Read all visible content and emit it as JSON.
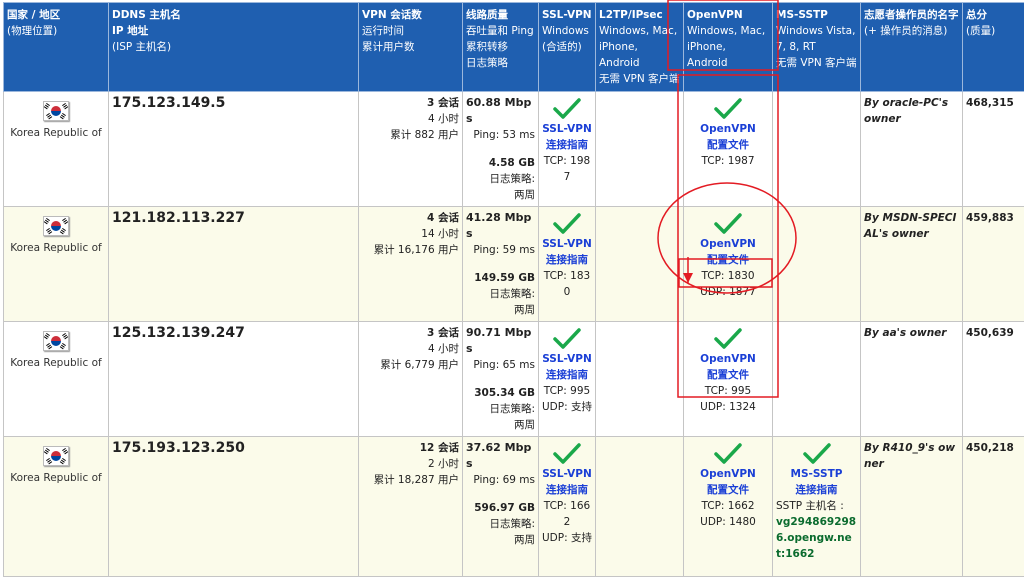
{
  "headers": {
    "country": [
      "国家 / 地区",
      "(物理位置)"
    ],
    "ddns": [
      "DDNS 主机名",
      "IP 地址",
      "(ISP 主机名)"
    ],
    "sessions": [
      "VPN 会话数",
      "运行时间",
      "累计用户数"
    ],
    "line": [
      "线路质量",
      "吞吐量和 Ping",
      "累积转移",
      "日志策略"
    ],
    "ssl": [
      "SSL-VPN",
      "Windows",
      "(合适的)"
    ],
    "l2tp": [
      "L2TP/IPsec",
      "Windows, Mac,",
      "iPhone, Android",
      "无需 VPN 客户端"
    ],
    "openvpn": [
      "OpenVPN",
      "Windows, Mac,",
      "iPhone, Android"
    ],
    "sstp": [
      "MS-SSTP",
      "Windows Vista,",
      "7, 8, RT",
      "无需 VPN 客户端"
    ],
    "owner": [
      "志愿者操作员的名字",
      "(+ 操作员的消息)"
    ],
    "score": [
      "总分",
      "(质量)"
    ]
  },
  "common": {
    "ssl_name": "SSL-VPN",
    "ssl_guide": "连接指南",
    "openvpn_name": "OpenVPN",
    "openvpn_config": "配置文件",
    "log_policy_label": "日志策略:",
    "sstp_name": "MS-SSTP",
    "sstp_guide": "连接指南",
    "sstp_host_label": "SSTP 主机名 :"
  },
  "rows": [
    {
      "country": "Korea Republic of",
      "ip": "175.123.149.5",
      "sessions": "3 会话",
      "uptime": "4 小时",
      "users": "累计 882 用户",
      "throughput": "60.88 Mbps",
      "ping": "Ping: 53 ms",
      "transfer": "4.58 GB",
      "log_policy": "两周",
      "ssl_tcp": "TCP: 1987",
      "ssl_udp": "",
      "ovpn_tcp": "TCP: 1987",
      "ovpn_udp": "",
      "sstp_host": "",
      "owner": "By oracle-PC's owner",
      "score": "468,315"
    },
    {
      "country": "Korea Republic of",
      "ip": "121.182.113.227",
      "sessions": "4 会话",
      "uptime": "14 小时",
      "users": "累计 16,176 用户",
      "throughput": "41.28 Mbps",
      "ping": "Ping: 59 ms",
      "transfer": "149.59 GB",
      "log_policy": "两周",
      "ssl_tcp": "TCP: 1830",
      "ssl_udp": "",
      "ovpn_tcp": "TCP: 1830",
      "ovpn_udp": "UDP: 1877",
      "sstp_host": "",
      "owner": "By MSDN-SPECIAL's owner",
      "score": "459,883"
    },
    {
      "country": "Korea Republic of",
      "ip": "125.132.139.247",
      "sessions": "3 会话",
      "uptime": "4 小时",
      "users": "累计 6,779 用户",
      "throughput": "90.71 Mbps",
      "ping": "Ping: 65 ms",
      "transfer": "305.34 GB",
      "log_policy": "两周",
      "ssl_tcp": "TCP: 995",
      "ssl_udp": "UDP: 支持",
      "ovpn_tcp": "TCP: 995",
      "ovpn_udp": "UDP: 1324",
      "sstp_host": "",
      "owner": "By aa's owner",
      "score": "450,639"
    },
    {
      "country": "Korea Republic of",
      "ip": "175.193.123.250",
      "sessions": "12 会话",
      "uptime": "2 小时",
      "users": "累计 18,287 用户",
      "throughput": "37.62 Mbps",
      "ping": "Ping: 69 ms",
      "transfer": "596.97 GB",
      "log_policy": "两周",
      "ssl_tcp": "TCP: 1662",
      "ssl_udp": "UDP: 支持",
      "ovpn_tcp": "TCP: 1662",
      "ovpn_udp": "UDP: 1480",
      "sstp_host": "vg2948692986.opengw.net:1662",
      "owner": "By R410_9's owner",
      "score": "450,218"
    }
  ],
  "colors": {
    "header_bg": "#1f5fb0",
    "row_alt_bg": "#fbfbea",
    "link": "#1a3fd6",
    "check": "#1aa84a",
    "sstp_host": "#0a6b2e",
    "annotation": "#e31b23"
  }
}
